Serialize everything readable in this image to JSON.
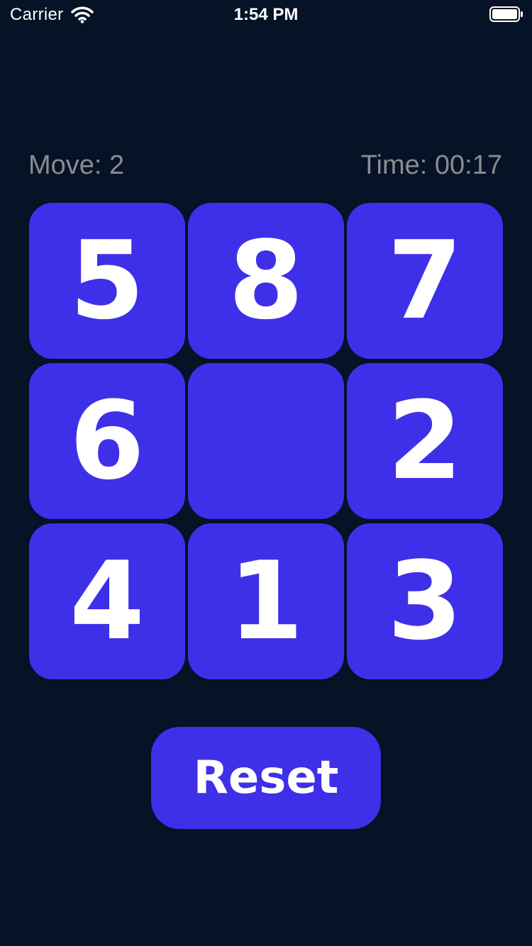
{
  "status_bar": {
    "carrier": "Carrier",
    "time": "1:54 PM",
    "wifi_icon": "wifi-icon",
    "battery_icon": "battery-icon"
  },
  "game": {
    "moves_label": "Move: 2",
    "time_label": "Time: 00:17",
    "tiles": [
      "5",
      "8",
      "7",
      "6",
      "",
      "2",
      "4",
      "1",
      "3"
    ],
    "reset_label": "Reset"
  },
  "colors": {
    "background": "#061226",
    "tile": "#3e30e8",
    "tile_text": "#ffffff",
    "info_text": "#8a8c8f"
  }
}
